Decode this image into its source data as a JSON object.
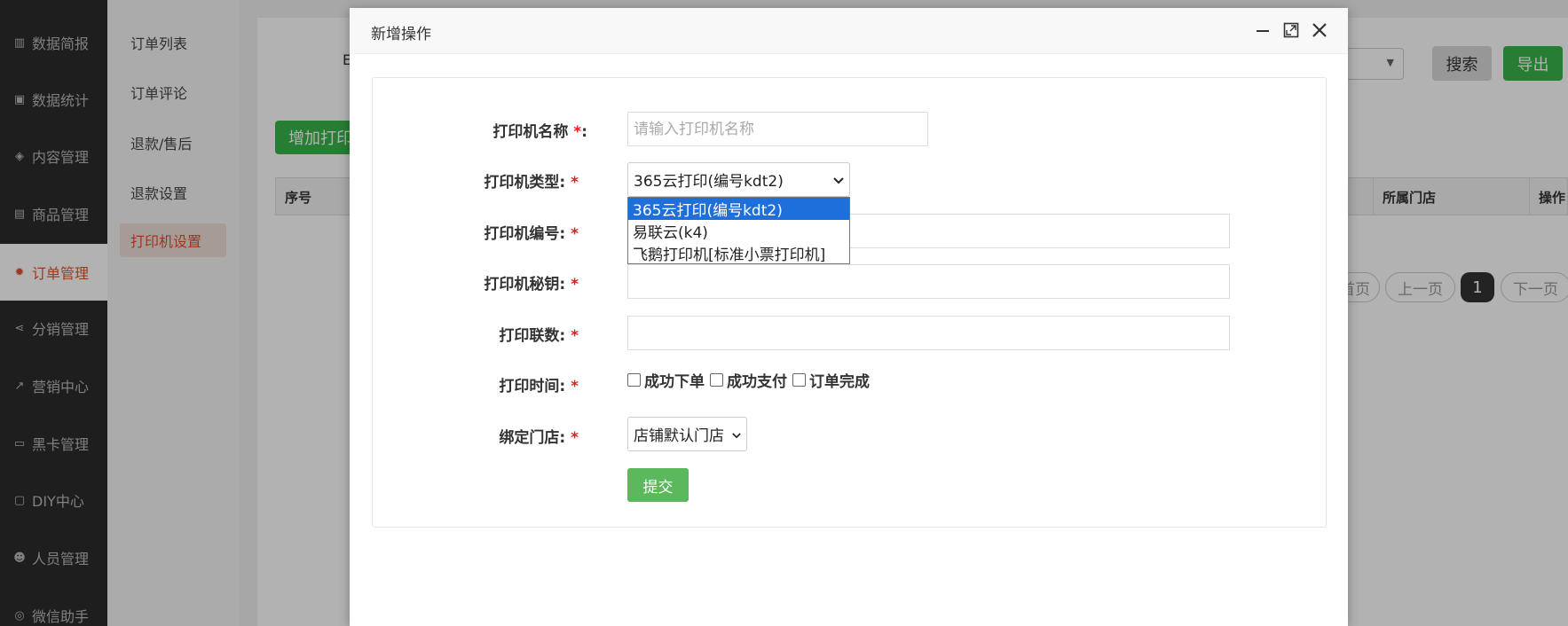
{
  "sidebar": {
    "items": [
      {
        "label": "数据简报",
        "icon": "bar-chart-icon"
      },
      {
        "label": "数据统计",
        "icon": "money-icon"
      },
      {
        "label": "内容管理",
        "icon": "tags-icon"
      },
      {
        "label": "商品管理",
        "icon": "shopping-bag-icon"
      },
      {
        "label": "订单管理",
        "icon": "gear-icon"
      },
      {
        "label": "分销管理",
        "icon": "share-icon"
      },
      {
        "label": "营销中心",
        "icon": "line-chart-icon"
      },
      {
        "label": "黑卡管理",
        "icon": "id-card-icon"
      },
      {
        "label": "DIY中心",
        "icon": "monitor-icon"
      },
      {
        "label": "人员管理",
        "icon": "users-icon"
      },
      {
        "label": "微信助手",
        "icon": "wechat-icon"
      }
    ]
  },
  "subnav": {
    "items": [
      "订单列表",
      "订单评论",
      "退款/售后",
      "退款设置",
      "打印机设置"
    ]
  },
  "page": {
    "search_label": "搜索",
    "export_label": "导出",
    "add_printer_label": "增加打印",
    "filter_fragment": "E",
    "table_headers": {
      "index": "序号",
      "store": "所属门店",
      "action": "操作"
    },
    "pagination": {
      "first": "首页",
      "prev": "上一页",
      "current": "1",
      "next": "下一页"
    }
  },
  "dialog": {
    "title": "新增操作",
    "fields": {
      "name": {
        "label": "打印机名称",
        "star": "*",
        "colon": ":",
        "placeholder": "请输入打印机名称"
      },
      "type": {
        "label": "打印机类型:",
        "star": "*",
        "value": "365云打印(编号kdt2)"
      },
      "number": {
        "label": "打印机编号:",
        "star": "*",
        "value": ""
      },
      "secret": {
        "label": "打印机秘钥:",
        "star": "*",
        "value": ""
      },
      "copies": {
        "label": "打印联数:",
        "star": "*",
        "value": ""
      },
      "time": {
        "label": "打印时间:",
        "star": "*",
        "options": [
          "成功下单",
          "成功支付",
          "订单完成"
        ]
      },
      "store": {
        "label": "绑定门店:",
        "star": "*",
        "value": "店铺默认门店"
      }
    },
    "type_options": [
      "365云打印(编号kdt2)",
      "易联云(k4)",
      "飞鹅打印机[标准小票打印机]"
    ],
    "submit_label": "提交"
  },
  "colors": {
    "accent": "#e0512c",
    "green": "#39b54a",
    "submit": "#5cb85c",
    "required": "#e02020",
    "dropdown_selected": "#1e6fd9"
  }
}
